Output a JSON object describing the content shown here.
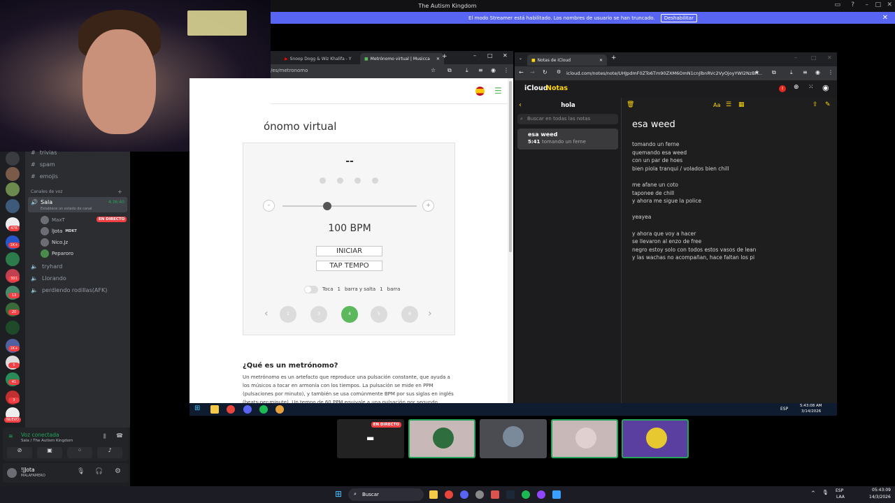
{
  "discord": {
    "window_title": "The Autism Kingdom",
    "streamer_banner": "El modo Streamer está habilitado. Los nombres de usuario se han truncado.",
    "streamer_button": "Deshabilitar",
    "text_channels": [
      "trivias",
      "spam",
      "emojis"
    ],
    "voice_category": "Canales de voz",
    "voice_channel": {
      "name": "Sala",
      "time": "4:36:40",
      "status": "Establece un estado de canal"
    },
    "voice_users": [
      {
        "name": "MaxT",
        "live": false
      },
      {
        "name": "lJota",
        "live": false,
        "tag": "MDKT"
      },
      {
        "name": "Nico.Jz",
        "live": false
      },
      {
        "name": "Peparoro",
        "live": false
      }
    ],
    "live_badge": "EN DIRECTO",
    "other_voice_channels": [
      "tryhard",
      "Llorando",
      "perdiendo rodillas(AFK)"
    ],
    "guild_badges": [
      "476",
      "1K+",
      "301",
      "13",
      "20",
      "1K+",
      "5",
      "41",
      "3",
      "NUEVO"
    ],
    "voice_connected": "Voz conectada",
    "voice_location": "Sala / The Autism Kingdom",
    "username": "!JJota",
    "user_status": "MALAFAMERO",
    "tile_live_badge": "EN DIRECTO"
  },
  "chrome_left": {
    "tabs": [
      "Snoop Dogg & Wiz Khalifa - Y",
      "Metrónomo virtual | Musicca"
    ],
    "url": "/es/metronomo",
    "heading": "ónomo virtual",
    "tempo_display": "--",
    "bpm": "100 BPM",
    "start_button": "INICIAR",
    "tap_button": "TAP TEMPO",
    "toggle_text": [
      "Toca",
      "1",
      "barra y salta",
      "1",
      "barra"
    ],
    "pages": [
      "2",
      "3",
      "4",
      "5",
      "6"
    ],
    "active_page": "4",
    "article_title": "¿Qué es un metrónomo?",
    "article_text": "Un metrónomo es un artefacto que reproduce una pulsación constante, que ayuda a los músicos a tocar en armonía con los tiempos. La pulsación se mide en PPM (pulsaciones por minuto), y también se usa comúnmente BPM por sus siglas en inglés (beats-per-minute). Un tempo de 60 PPM equivale a una pulsación por segundo, mientras que el de"
  },
  "icloud": {
    "tab": "Notas de iCloud",
    "url": "icloud.com/notes/note/UHJpdmF0ZTo6Tm90ZXM6OmN1cnJlbnRVc2VyOjoyYWI2NzBh...",
    "brand": "iCloud",
    "app": "Notas",
    "folder": "hola",
    "search_placeholder": "Buscar en todas las notas",
    "note_item": {
      "title": "esa weed",
      "time": "5:41",
      "preview": "tomando un ferne"
    },
    "note_title": "esa weed",
    "note_lines": [
      "tomando un ferne",
      "quemando esa weed",
      "con un par de hoes",
      "bien piola tranqui / volados bien chill",
      "",
      "me afane un coto",
      "taponee de chill",
      "y ahora me sigue la police",
      "",
      "yeayea",
      "",
      "y ahora que voy a hacer",
      "se llevaron al enzo de free",
      "negro estoy solo con todos estos vasos de lean",
      "y las wachas no acompañan, hace faltan los pi"
    ]
  },
  "inner_taskbar": {
    "lang": "ESP",
    "time": "5:43:08 AM",
    "date": "3/14/2026"
  },
  "taskbar": {
    "search": "Buscar",
    "lang": "ESP",
    "lang2": "LAA",
    "time": "05:43:09",
    "date": "14/3/2026"
  },
  "colors": {
    "discord_blurple": "#5865f2",
    "metronome_green": "#5cb85c",
    "icloud_yellow": "#ffd60a",
    "live_red": "#f23f43"
  }
}
